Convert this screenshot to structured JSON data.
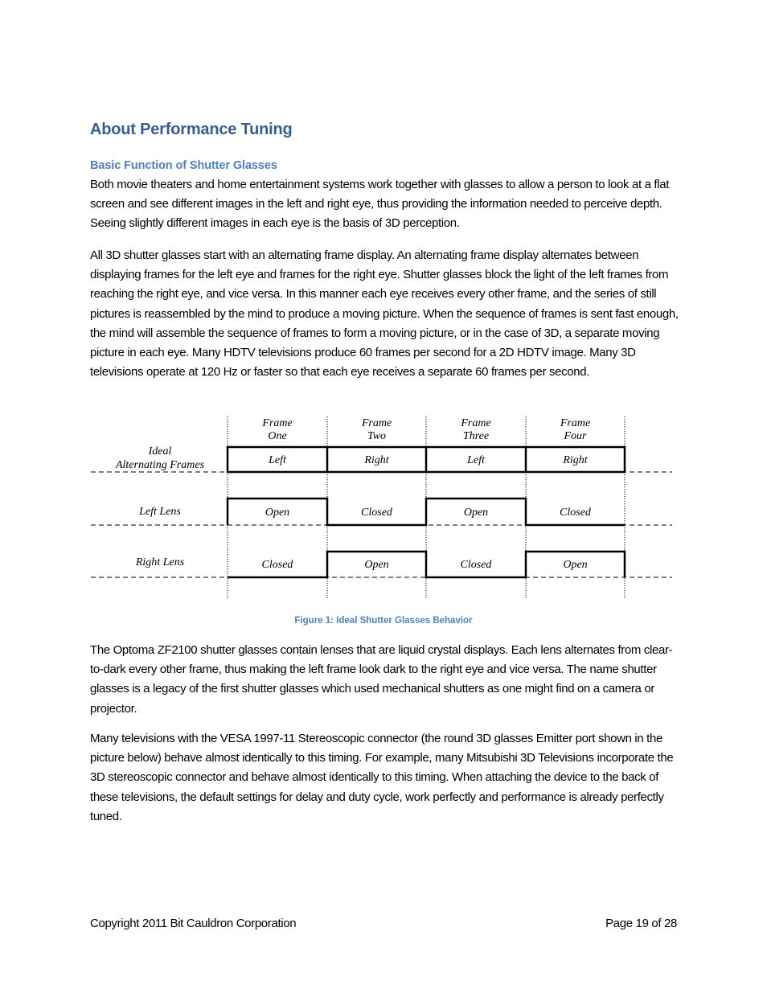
{
  "document": {
    "heading": "About Performance Tuning",
    "subheading": "Basic Function of Shutter Glasses",
    "paragraphs": [
      "Both movie theaters and home entertainment systems work together with glasses to allow a person to look at a flat screen and see different images in the left and right eye, thus providing the information needed to perceive depth. Seeing slightly different images in each eye is the basis of 3D perception.",
      "All 3D shutter glasses start with an alternating frame display. An alternating frame display alternates between displaying frames for the left eye and frames for the right eye. Shutter glasses block the light of the left frames from reaching the right eye, and vice versa.  In this manner each eye receives every other frame, and the series of still pictures is reassembled by the mind to produce a moving picture. When the sequence of frames is sent fast enough, the mind will assemble the sequence of frames to form a moving picture, or in the case of 3D, a separate moving picture in each eye. Many HDTV televisions produce 60 frames per second for a 2D HDTV image. Many 3D televisions operate at 120 Hz or faster so that each eye receives a separate 60 frames per second.",
      "The Optoma ZF2100  shutter glasses contain lenses that are liquid crystal displays. Each lens alternates from clear-to-dark every other frame, thus making the left frame look dark to the right eye and vice versa. The name shutter glasses is a legacy of the first shutter glasses which used mechanical shutters as one might find on a camera or projector.",
      "Many televisions with the VESA 1997-11 Stereoscopic connector (the round 3D glasses Emitter port shown in the picture below) behave almost identically to this timing. For example, many Mitsubishi 3D Televisions incorporate the 3D stereoscopic connector and behave almost identically to this timing. When attaching the device to the back of these televisions, the default settings for delay and duty cycle, work perfectly and performance is already perfectly tuned."
    ],
    "figure_caption": "Figure 1: Ideal Shutter Glasses Behavior"
  },
  "diagram": {
    "frames": [
      {
        "line1": "Frame",
        "line2": "One"
      },
      {
        "line1": "Frame",
        "line2": "Two"
      },
      {
        "line1": "Frame",
        "line2": "Three"
      },
      {
        "line1": "Frame",
        "line2": "Four"
      }
    ],
    "rows": [
      {
        "label_line1": "Ideal",
        "label_line2": "Alternating Frames",
        "type": "frames",
        "cells": [
          "Left",
          "Right",
          "Left",
          "Right"
        ]
      },
      {
        "label": "Left Lens",
        "type": "signal",
        "cells": [
          "Open",
          "Closed",
          "Open",
          "Closed"
        ],
        "levels": [
          1,
          0,
          1,
          0
        ]
      },
      {
        "label": "Right Lens",
        "type": "signal",
        "cells": [
          "Closed",
          "Open",
          "Closed",
          "Open"
        ],
        "levels": [
          0,
          1,
          0,
          1
        ]
      }
    ]
  },
  "footer": {
    "copyright": "Copyright 2011 Bit Cauldron Corporation",
    "page": "Page 19 of 28"
  },
  "colors": {
    "heading": "#365f91",
    "subheading": "#4f81bd",
    "caption": "#4f81bd"
  }
}
